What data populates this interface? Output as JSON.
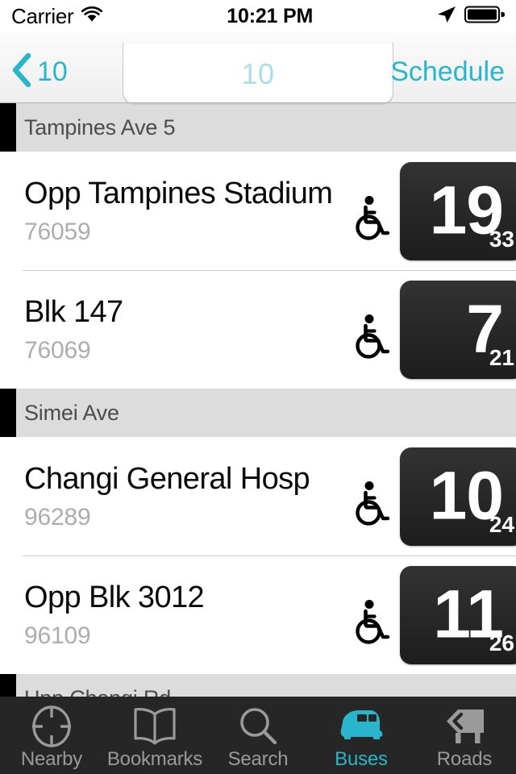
{
  "statusbar": {
    "carrier": "Carrier",
    "wifi_icon": "wifi-icon",
    "time": "10:21 PM",
    "location_icon": "location-arrow-icon",
    "battery_icon": "battery-full-icon"
  },
  "navbar": {
    "back_icon": "chevron-left-icon",
    "back_label": "10",
    "title": "10",
    "right_label": "Schedule"
  },
  "colors": {
    "accent": "#29b6cc",
    "title_tint": "#a9dfe8",
    "section_bg": "#dcdcdc",
    "badge_bg": "#2b2b2b",
    "tabbar_bg": "#262626",
    "tab_inactive": "#9a9a9a"
  },
  "list": {
    "sections": [
      {
        "title": "Tampines Ave 5",
        "stops": [
          {
            "name": "Opp Tampines Stadium",
            "code": "76059",
            "accessible_icon": "wheelchair-icon",
            "eta_primary": "19",
            "eta_secondary": "33"
          },
          {
            "name": "Blk 147",
            "code": "76069",
            "accessible_icon": "wheelchair-icon",
            "eta_primary": "7",
            "eta_secondary": "21"
          }
        ]
      },
      {
        "title": "Simei Ave",
        "stops": [
          {
            "name": "Changi General Hosp",
            "code": "96289",
            "accessible_icon": "wheelchair-icon",
            "eta_primary": "10",
            "eta_secondary": "24"
          },
          {
            "name": "Opp Blk 3012",
            "code": "96109",
            "accessible_icon": "wheelchair-icon",
            "eta_primary": "11",
            "eta_secondary": "26"
          }
        ]
      },
      {
        "title": "Upp Changi Rd",
        "stops": []
      }
    ]
  },
  "tabbar": {
    "items": [
      {
        "label": "Nearby",
        "icon": "crosshair-icon",
        "active": false
      },
      {
        "label": "Bookmarks",
        "icon": "book-icon",
        "active": false
      },
      {
        "label": "Search",
        "icon": "search-icon",
        "active": false
      },
      {
        "label": "Buses",
        "icon": "bus-icon",
        "active": true
      },
      {
        "label": "Roads",
        "icon": "road-sign-icon",
        "active": false
      }
    ]
  }
}
